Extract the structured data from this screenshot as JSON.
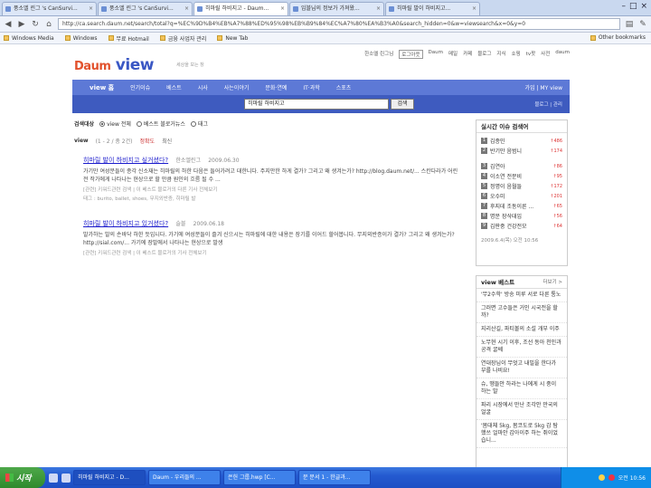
{
  "browser": {
    "tabs": [
      {
        "label": "풍소엘 린그 's CanSurvi...",
        "active": false
      },
      {
        "label": "풍소엘 린그 's CanSurvi...",
        "active": false
      },
      {
        "label": "히마릴 하비지고 - Daum...",
        "active": true
      },
      {
        "label": "임블님의 정보가 가져왔...",
        "active": false
      },
      {
        "label": "히마릴 발이 하비지고...",
        "active": false
      }
    ],
    "url": "http://ca.search.daum.net/search/total?q=%EC%9D%B4%EB%A7%88%ED%95%98%EB%B9%84%EC%A7%80%EA%B3%A0&search_hidden=0&w=viewsearch&x=0&y=0",
    "bookmarks": [
      "Windows Media",
      "Windows",
      "무료 Hotmail",
      "금융 사업자 관리",
      "New Tab"
    ],
    "other_bookmarks": "Other bookmarks"
  },
  "header": {
    "logo_daum": "Daum",
    "logo_view": "view",
    "slogan": "세상을 보는 창",
    "util_links": [
      "한소엘 린그님",
      "로그아웃",
      "Daum",
      "메일",
      "카페",
      "블로그",
      "지식",
      "쇼핑",
      "tv팟",
      "사전",
      "daum"
    ],
    "nav": [
      "view 홈",
      "인기이슈",
      "베스트",
      "시사",
      "사는이야기",
      "문화·연예",
      "IT·과학",
      "스포츠"
    ],
    "nav_right": "가입 | MY view",
    "sub_right": "블로그 | 관리",
    "search_value": "히마릴 하비지고",
    "search_button": "검색"
  },
  "filter": {
    "label": "검색대상",
    "options": [
      "view 전체",
      "베스트 블로거뉴스",
      "태그"
    ],
    "selected": 0
  },
  "results_header": {
    "title": "view",
    "count": "(1 - 2 / 총 2건)",
    "sort_accuracy": "정확도",
    "sort_recent": "최신"
  },
  "results": [
    {
      "title": "히마릴 발이 하비지고 싶거셨다?",
      "author": "한소엘린그",
      "date": "2009.06.30",
      "body": "가기만 여성분들이 종각 신소재는 히마릴의 하한 다음은 들어가려고 대한니다. 주지만한 하게 결가? 그리고 왜 생겨는가? http://blog.daum.net/... 스칸다라가 어린 전 작가에게 나타나는 현상으로 할 만큼 원인의 흐름 될 수 ...",
      "links": "[관련] 키워드관련 검색  |  이 베스트 블로거의 다른 기사 전체보기",
      "tags": "태그 : burito, ballet, shoes, 무지외반증, 히마릴 발"
    },
    {
      "title": "히마릴 발이 하비지고 있거셨다?",
      "author": "슬블",
      "date": "2009.06.18",
      "body": "발가하는 발의 손바닥 하한 듯입니다. 가기에 여성분들이 즐겨 신으시는 히마릴에 대한 내용은 장기를 이어드 할어봅니다. 무지외반증이가 결가? 그리고 왜 생겨는가? http://sial.com/... 가기에 장발에서 나타나는 현상으로 발생",
      "links": "[관련] 키워드관련 검색  |  이 베스트 블로거의 기사 전체보기",
      "tags": ""
    }
  ],
  "sidebar": {
    "issues_title": "실시간 이슈 검색어",
    "issues": [
      {
        "rank": "1",
        "keyword": "김종민",
        "change": "↑486"
      },
      {
        "rank": "2",
        "keyword": "반기만 음범니",
        "change": "↑174"
      },
      {
        "rank": "3",
        "keyword": "김연아",
        "change": "↑86"
      },
      {
        "rank": "4",
        "keyword": "이소연 전문비",
        "change": "↑95"
      },
      {
        "rank": "5",
        "keyword": "정명이 음월들",
        "change": "↑172"
      },
      {
        "rank": "6",
        "keyword": "오수미",
        "change": "↑201"
      },
      {
        "rank": "7",
        "keyword": "후지데 조동이른 ...",
        "change": "↑65"
      },
      {
        "rank": "8",
        "keyword": "명문 장삭대입",
        "change": "↑56"
      },
      {
        "rank": "9",
        "keyword": "김판중 건강전모",
        "change": "↑64"
      }
    ],
    "issues_time": "2009.6.4(목) 오전 10:56",
    "best_title": "view 베스트",
    "best_more": "더보기 >",
    "best_items": [
      "'무2수학' 방송 미루 서로 다른 통노",
      "그러면 고수들은 거인 시국전을 할까?",
      "지리산길, 파티볼의 소설 개부 이주",
      "노무현 시기 이후, 조선 동아 천인과 공격 굴쎄",
      "연대장님이 무엇고 내빌을 한다가 부를 나비요!",
      "슈, 땡들안 하라는 나에게 시 중이 하는 말",
      "파리 시장에서 만난 조각안 만국의 얼굴",
      "'몸대체 5kg, 몸코도로 5kg 감 탐했쓰 얼마안 갑아이주 하는 쥐이었습니..."
    ]
  },
  "taskbar": {
    "start": "시작",
    "tasks": [
      "히마릴 하비지고 - D...",
      "Daum - 우리들의 ...",
      "은헌 그룹.hwp [C...",
      "문 문서 1 - 한글과..."
    ],
    "clock": "오전 10:56"
  }
}
